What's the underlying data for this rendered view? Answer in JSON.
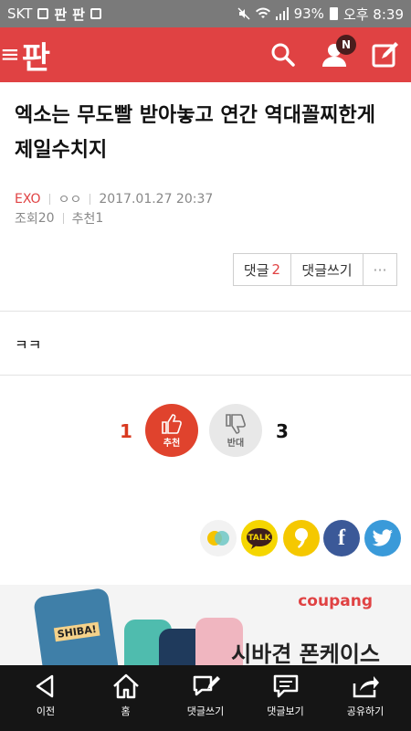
{
  "status_bar": {
    "carrier": "SKT",
    "app_icons": [
      "판",
      "판"
    ],
    "battery": "93%",
    "time": "오후 8:39"
  },
  "app_bar": {
    "brand": "판",
    "notification_badge": "N",
    "colors": {
      "brand": "#e04243"
    }
  },
  "post": {
    "title": "엑소는 무도빨 받아놓고 연간 역대꼴찌한게 제일수치지",
    "category": "EXO",
    "author": "ㅇㅇ",
    "datetime": "2017.01.27 20:37",
    "views_label": "조회",
    "views": "20",
    "recommends_label": "추천",
    "recommends": "1",
    "body": "ㅋㅋ"
  },
  "actions": {
    "comments_label": "댓글",
    "comments_count": "2",
    "write_comment_label": "댓글쓰기",
    "more_label": "···"
  },
  "vote": {
    "recommend_count": "1",
    "recommend_label": "추천",
    "oppose_label": "반대",
    "oppose_count": "3"
  },
  "share_icons": [
    "kakaostory-icon",
    "kakaotalk-icon",
    "kakaopage-icon",
    "facebook-icon",
    "twitter-icon"
  ],
  "share": {
    "kakao_label": "TALK",
    "facebook_label": "f"
  },
  "ad": {
    "brand": "coupang",
    "headline": "시바견 폰케이스",
    "phone_label": "SHIBA!"
  },
  "bottom_nav": [
    {
      "label": "이전",
      "icon": "back-arrow-icon"
    },
    {
      "label": "홈",
      "icon": "home-icon"
    },
    {
      "label": "댓글쓰기",
      "icon": "write-comment-icon"
    },
    {
      "label": "댓글보기",
      "icon": "view-comments-icon"
    },
    {
      "label": "공유하기",
      "icon": "share-icon"
    }
  ]
}
